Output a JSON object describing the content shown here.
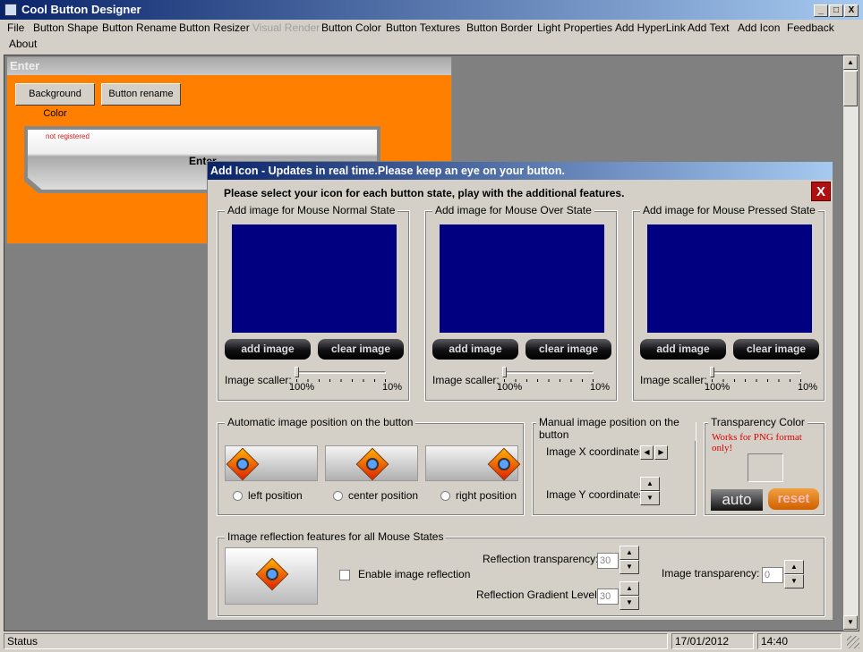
{
  "window": {
    "title": "Cool Button Designer",
    "icon": "app-icon",
    "controls": [
      "_",
      "□",
      "X"
    ]
  },
  "menu": [
    {
      "label": "File",
      "enabled": true
    },
    {
      "label": "Button Shape",
      "enabled": true
    },
    {
      "label": "Button Rename",
      "enabled": true
    },
    {
      "label": "Button Resizer",
      "enabled": true
    },
    {
      "label": "Visual Render",
      "enabled": false
    },
    {
      "label": "Button Color",
      "enabled": true
    },
    {
      "label": "Button Textures",
      "enabled": true
    },
    {
      "label": "Button Border",
      "enabled": true
    },
    {
      "label": "Light Properties",
      "enabled": true
    },
    {
      "label": "Add HyperLink",
      "enabled": true
    },
    {
      "label": "Add Text",
      "enabled": true
    },
    {
      "label": "Add Icon",
      "enabled": true
    },
    {
      "label": "Feedback",
      "enabled": true
    },
    {
      "label": "About",
      "enabled": true
    }
  ],
  "child": {
    "title": "Enter",
    "bg_color_btn": "Background Color",
    "rename_btn": "Button rename",
    "preview_watermark": "not registered",
    "preview_text": "Enter",
    "bg_color": "#ff8000"
  },
  "dialog": {
    "title": "Add Icon - Updates in real time.Please keep an eye on your button.",
    "instruction": "Please select your icon for each button state, play with the additional features.",
    "close": "X",
    "states": [
      {
        "label": "Add image for Mouse Normal State",
        "add": "add image",
        "clear": "clear image",
        "scaler_label": "Image scaller:",
        "min": "100%",
        "max": "10%",
        "scale_value": 100
      },
      {
        "label": "Add image for Mouse Over State",
        "add": "add image",
        "clear": "clear image",
        "scaler_label": "Image scaller:",
        "min": "100%",
        "max": "10%",
        "scale_value": 100
      },
      {
        "label": "Add image for Mouse Pressed State",
        "add": "add image",
        "clear": "clear image",
        "scaler_label": "Image scaller:",
        "min": "100%",
        "max": "10%",
        "scale_value": 100
      }
    ],
    "auto": {
      "label": "Automatic image position on the button",
      "left": "left position",
      "center": "center position",
      "right": "right position"
    },
    "manual": {
      "label": "Manual image position on the button",
      "x": "Image X coordinates:",
      "y": "Image Y coordinates:"
    },
    "transparency": {
      "label": "Transparency Color",
      "note": "Works for PNG format only!",
      "auto": "auto",
      "reset": "reset"
    },
    "reflection": {
      "label": "Image reflection features for all Mouse States",
      "enable": "Enable image reflection",
      "enabled": false,
      "trans_label": "Reflection transparency:",
      "trans_value": "30",
      "grad_label": "Reflection Gradient Level:",
      "grad_value": "30",
      "img_trans_label": "Image transparency:",
      "img_trans_value": "0"
    }
  },
  "status": {
    "text": "Status",
    "date": "17/01/2012",
    "time": "14:40"
  }
}
